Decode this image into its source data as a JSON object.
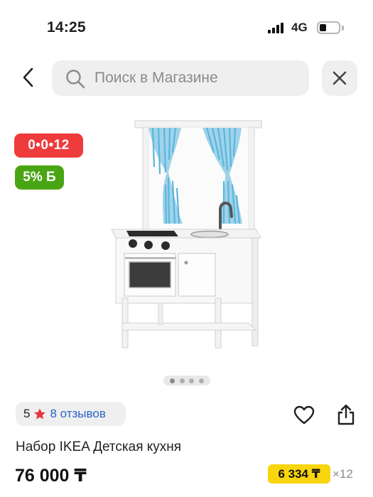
{
  "status_bar": {
    "time": "14:25",
    "network": "4G",
    "battery_level": 0.35
  },
  "search": {
    "placeholder": "Поиск в Магазине"
  },
  "badges": {
    "timer": "0•0•12",
    "bonus": "5% Б"
  },
  "gallery": {
    "dot_count": 4,
    "active_index": 0
  },
  "rating": {
    "value": "5",
    "reviews_label": "8 отзывов"
  },
  "product": {
    "title": "Набор IKEA Детская кухня",
    "price": "76 000 ₸",
    "installment_price": "6 334 ₸",
    "installment_count": "×12"
  },
  "colors": {
    "timer_badge": "#ef3b3b",
    "bonus_badge": "#4aa514",
    "installment_badge": "#f8d50c",
    "link": "#2a64c9",
    "star": "#e8343c"
  },
  "icons": [
    "back-arrow-icon",
    "search-icon",
    "close-icon",
    "star-icon",
    "heart-icon",
    "share-icon"
  ]
}
